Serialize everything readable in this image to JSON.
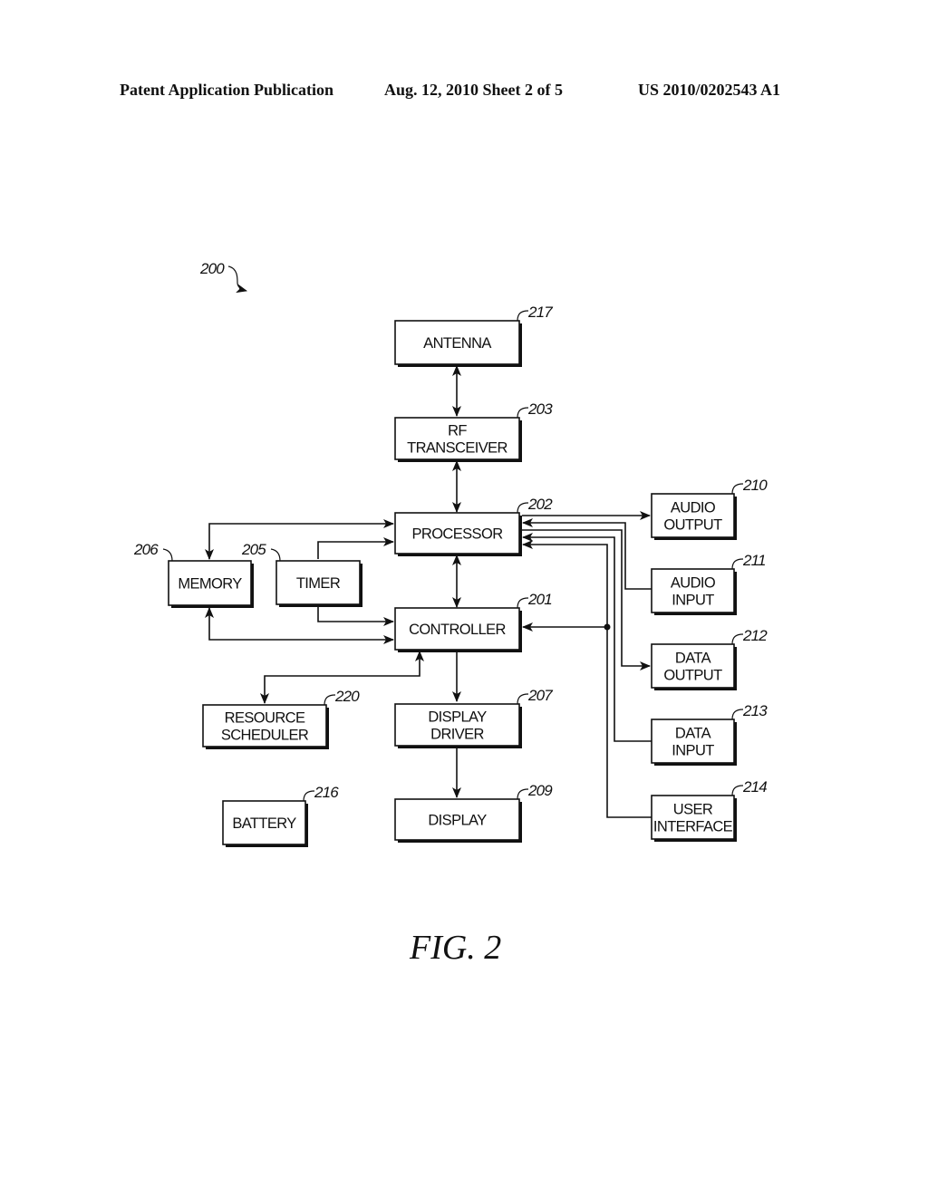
{
  "header": {
    "publication": "Patent Application Publication",
    "date_sheet": "Aug. 12, 2010  Sheet 2 of 5",
    "number": "US 2010/0202543 A1"
  },
  "figure": {
    "ref": "200",
    "caption": "FIG. 2"
  },
  "blocks": {
    "antenna": {
      "ref": "217",
      "lines": [
        "ANTENNA"
      ]
    },
    "rf_transceiver": {
      "ref": "203",
      "lines": [
        "RF",
        "TRANSCEIVER"
      ]
    },
    "processor": {
      "ref": "202",
      "lines": [
        "PROCESSOR"
      ]
    },
    "controller": {
      "ref": "201",
      "lines": [
        "CONTROLLER"
      ]
    },
    "memory": {
      "ref": "206",
      "lines": [
        "MEMORY"
      ]
    },
    "timer": {
      "ref": "205",
      "lines": [
        "TIMER"
      ]
    },
    "resource_scheduler": {
      "ref": "220",
      "lines": [
        "RESOURCE",
        "SCHEDULER"
      ]
    },
    "display_driver": {
      "ref": "207",
      "lines": [
        "DISPLAY",
        "DRIVER"
      ]
    },
    "display": {
      "ref": "209",
      "lines": [
        "DISPLAY"
      ]
    },
    "battery": {
      "ref": "216",
      "lines": [
        "BATTERY"
      ]
    },
    "audio_output": {
      "ref": "210",
      "lines": [
        "AUDIO",
        "OUTPUT"
      ]
    },
    "audio_input": {
      "ref": "211",
      "lines": [
        "AUDIO",
        "INPUT"
      ]
    },
    "data_output": {
      "ref": "212",
      "lines": [
        "DATA",
        "OUTPUT"
      ]
    },
    "data_input": {
      "ref": "213",
      "lines": [
        "DATA",
        "INPUT"
      ]
    },
    "user_interface": {
      "ref": "214",
      "lines": [
        "USER",
        "INTERFACE"
      ]
    }
  },
  "connections": [
    {
      "from": "antenna",
      "to": "rf_transceiver",
      "direction": "bidirectional"
    },
    {
      "from": "rf_transceiver",
      "to": "processor",
      "direction": "bidirectional"
    },
    {
      "from": "processor",
      "to": "controller",
      "direction": "bidirectional"
    },
    {
      "from": "memory",
      "to": "processor",
      "direction": "bidirectional"
    },
    {
      "from": "memory",
      "to": "controller",
      "direction": "bidirectional"
    },
    {
      "from": "timer",
      "to": "processor",
      "direction": "forward"
    },
    {
      "from": "timer",
      "to": "controller",
      "direction": "forward"
    },
    {
      "from": "controller",
      "to": "resource_scheduler",
      "direction": "bidirectional"
    },
    {
      "from": "controller",
      "to": "display_driver",
      "direction": "forward"
    },
    {
      "from": "display_driver",
      "to": "display",
      "direction": "forward"
    },
    {
      "from": "processor",
      "to": "audio_output",
      "direction": "forward"
    },
    {
      "from": "audio_input",
      "to": "processor",
      "direction": "forward"
    },
    {
      "from": "processor",
      "to": "data_output",
      "direction": "forward"
    },
    {
      "from": "data_input",
      "to": "processor",
      "direction": "forward"
    },
    {
      "from": "user_interface",
      "to": "processor",
      "direction": "forward"
    },
    {
      "from": "user_interface",
      "to": "controller",
      "direction": "forward"
    }
  ]
}
